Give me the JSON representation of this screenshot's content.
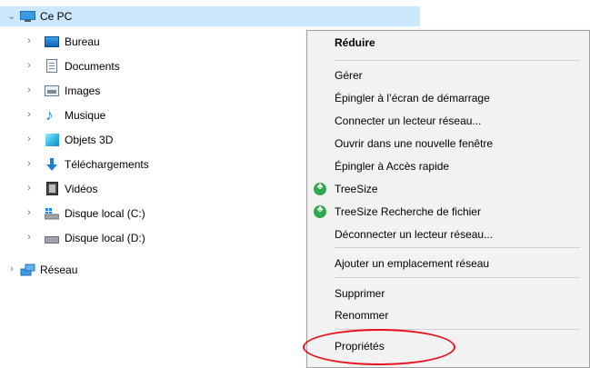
{
  "tree": {
    "root": {
      "label": "Ce PC",
      "icon": "computer-icon"
    },
    "items": [
      {
        "label": "Bureau",
        "icon": "desktop-folder-icon"
      },
      {
        "label": "Documents",
        "icon": "documents-folder-icon"
      },
      {
        "label": "Images",
        "icon": "pictures-folder-icon"
      },
      {
        "label": "Musique",
        "icon": "music-folder-icon"
      },
      {
        "label": "Objets 3D",
        "icon": "3d-objects-folder-icon"
      },
      {
        "label": "Téléchargements",
        "icon": "downloads-folder-icon"
      },
      {
        "label": "Vidéos",
        "icon": "videos-folder-icon"
      },
      {
        "label": "Disque local (C:)",
        "icon": "windows-drive-icon"
      },
      {
        "label": "Disque local (D:)",
        "icon": "drive-icon"
      }
    ],
    "network": {
      "label": "Réseau",
      "icon": "network-icon"
    }
  },
  "menu": {
    "collapse": "Réduire",
    "manage": "Gérer",
    "pin_start": "Épingler à l’écran de démarrage",
    "map_drive": "Connecter un lecteur réseau...",
    "open_new_window": "Ouvrir dans une nouvelle fenêtre",
    "pin_quick": "Épingler à Accès rapide",
    "treesize": "TreeSize",
    "treesize_search": "TreeSize Recherche de fichier",
    "disconnect_drive": "Déconnecter un lecteur réseau...",
    "add_network_location": "Ajouter un emplacement réseau",
    "delete": "Supprimer",
    "rename": "Renommer",
    "properties": "Propriétés"
  },
  "colors": {
    "selection": "#cce8ff",
    "menu_bg": "#f2f2f2",
    "highlight_ellipse": "#e8101c",
    "treesize_icon": "#2fa84f"
  }
}
